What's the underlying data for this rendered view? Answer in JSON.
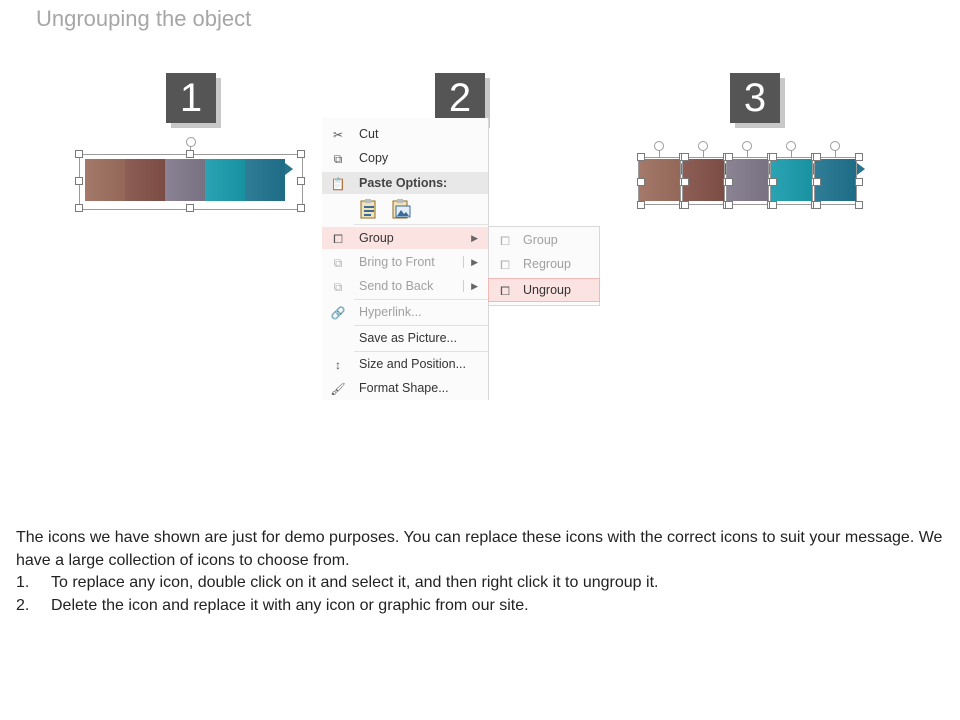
{
  "title": "Ungrouping the object",
  "steps": [
    "1",
    "2",
    "3"
  ],
  "segment_colors": [
    "#a5796a",
    "#8c5e56",
    "#8a8394",
    "#2aa3b3",
    "#2f7d97"
  ],
  "menu": {
    "items": [
      {
        "label": "Cut",
        "icon": "scissors-icon",
        "enabled": true
      },
      {
        "label": "Copy",
        "icon": "copy-icon",
        "enabled": true
      },
      {
        "label": "Paste Options:",
        "icon": "clipboard-icon",
        "enabled": true
      },
      {
        "label": "Group",
        "icon": "group-icon",
        "enabled": true
      },
      {
        "label": "Bring to Front",
        "icon": "bring-front-icon",
        "enabled": false
      },
      {
        "label": "Send to Back",
        "icon": "send-back-icon",
        "enabled": false
      },
      {
        "label": "Hyperlink...",
        "icon": "link-icon",
        "enabled": false
      },
      {
        "label": "Save as Picture...",
        "icon": "",
        "enabled": true
      },
      {
        "label": "Size and Position...",
        "icon": "size-icon",
        "enabled": true
      },
      {
        "label": "Format Shape...",
        "icon": "format-icon",
        "enabled": true
      }
    ]
  },
  "submenu": {
    "items": [
      {
        "label": "Group",
        "enabled": false
      },
      {
        "label": "Regroup",
        "enabled": false
      },
      {
        "label": "Ungroup",
        "enabled": true
      }
    ]
  },
  "description": {
    "intro": "The icons we have shown are just for demo purposes. You can replace these icons with the correct icons to suit your message. We have a large collection of icons to choose from.",
    "list": [
      {
        "num": "1.",
        "text": "To replace any icon, double click on it and select it, and then right click it to ungroup it."
      },
      {
        "num": "2.",
        "text": "Delete the icon and replace it with any icon or graphic from our site."
      }
    ]
  }
}
